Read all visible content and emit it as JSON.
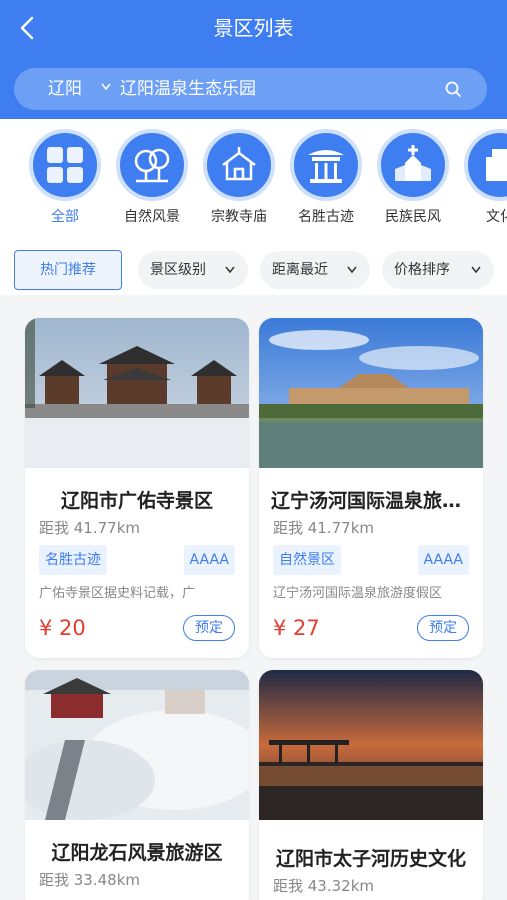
{
  "header": {
    "title": "景区列表"
  },
  "search": {
    "city": "辽阳",
    "query": "辽阳温泉生态乐园"
  },
  "categories": [
    {
      "label": "全部",
      "icon": "grid-icon",
      "active": true
    },
    {
      "label": "自然风景",
      "icon": "tree-icon"
    },
    {
      "label": "宗教寺庙",
      "icon": "temple-icon"
    },
    {
      "label": "名胜古迹",
      "icon": "pavilion-icon"
    },
    {
      "label": "民族民风",
      "icon": "church-icon"
    },
    {
      "label": "文化",
      "icon": "building-icon"
    }
  ],
  "filters": {
    "hot": "热门推荐",
    "level": "景区级别",
    "distance": "距离最近",
    "price": "价格排序"
  },
  "cards": [
    {
      "name": "辽阳市广佑寺景区",
      "distance": "距我 41.77km",
      "type": "名胜古迹",
      "level": "AAAA",
      "desc": "广佑寺景区据史料记载，广",
      "price": "¥ 20",
      "book": "预定"
    },
    {
      "name": "辽宁汤河国际温泉旅游度假区",
      "distance": "距我 41.77km",
      "type": "自然景区",
      "level": "AAAA",
      "desc": "辽宁汤河国际温泉旅游度假区",
      "price": "¥ 27",
      "book": "预定"
    },
    {
      "name": "辽阳龙石风景旅游区",
      "distance": "距我 33.48km"
    },
    {
      "name": "辽阳市太子河历史文化",
      "distance": "距我 43.32km"
    }
  ],
  "colors": {
    "primary": "#3f7ef0",
    "price": "#e33d2f"
  }
}
